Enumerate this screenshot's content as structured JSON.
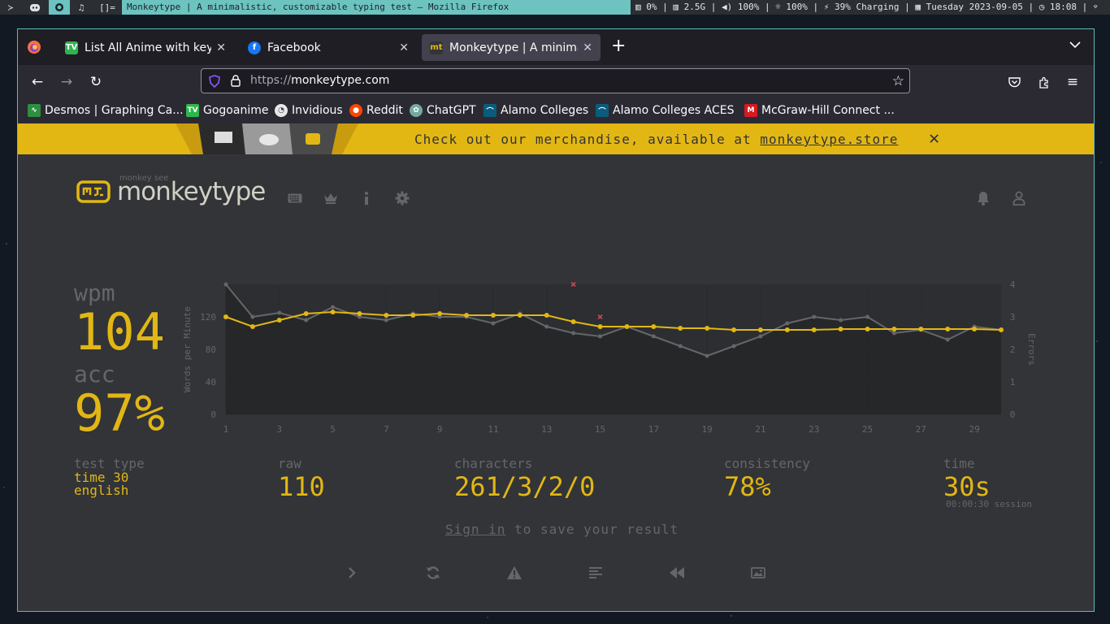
{
  "system_bar": {
    "window_title": "Monkeytype | A minimalistic, customizable typing test — Mozilla Firefox",
    "status_text": "▥ 0% | ▥ 2.5G | ◀) 100% | ☼ 100% | ⚡ 39% Charging | ▦ Tuesday 2023-09-05 | ◷ 18:08 | ⌔"
  },
  "browser": {
    "tabs": [
      {
        "label": "List All Anime with keyw",
        "active": false
      },
      {
        "label": "Facebook",
        "active": false
      },
      {
        "label": "Monkeytype | A minimal",
        "active": true
      }
    ],
    "url_protocol": "https://",
    "url_host": "monkeytype.com",
    "bookmarks": [
      "Desmos | Graphing Ca...",
      "Gogoanime",
      "Invidious",
      "Reddit",
      "ChatGPT",
      "Alamo Colleges",
      "Alamo Colleges ACES",
      "McGraw-Hill Connect ..."
    ]
  },
  "banner": {
    "text": "Check out our merchandise, available at ",
    "link": "monkeytype.store"
  },
  "header": {
    "tagline": "monkey see",
    "brand": "monkeytype"
  },
  "result": {
    "wpm_label": "wpm",
    "wpm": "104",
    "acc_label": "acc",
    "acc": "97%",
    "test_type_label": "test type",
    "test_type_1": "time 30",
    "test_type_2": "english",
    "raw_label": "raw",
    "raw": "110",
    "characters_label": "characters",
    "characters": "261/3/2/0",
    "consistency_label": "consistency",
    "consistency": "78%",
    "time_label": "time",
    "time": "30s",
    "session": "00:00:30 session",
    "signin_link": "Sign in",
    "signin_rest": " to save your result"
  },
  "chart_data": {
    "type": "line",
    "ylabel": "Words per Minute",
    "y2label": "Errors",
    "ylim": [
      0,
      160
    ],
    "y2lim": [
      0,
      4
    ],
    "yticks": [
      "0",
      "40",
      "80",
      "120"
    ],
    "y2ticks": [
      "0",
      "1",
      "2",
      "3",
      "4"
    ],
    "xticks": [
      "1",
      "3",
      "5",
      "7",
      "9",
      "11",
      "13",
      "15",
      "17",
      "19",
      "21",
      "23",
      "25",
      "27",
      "29"
    ],
    "x": [
      1,
      2,
      3,
      4,
      5,
      6,
      7,
      8,
      9,
      10,
      11,
      12,
      13,
      14,
      15,
      16,
      17,
      18,
      19,
      20,
      21,
      22,
      23,
      24,
      25,
      26,
      27,
      28,
      29,
      30
    ],
    "series": [
      {
        "name": "raw",
        "color": "#646669",
        "values": [
          160,
          120,
          125,
          116,
          132,
          120,
          116,
          124,
          120,
          120,
          112,
          124,
          108,
          100,
          96,
          108,
          96,
          84,
          72,
          84,
          96,
          112,
          120,
          116,
          120,
          100,
          104,
          92,
          108,
          104
        ]
      },
      {
        "name": "wpm",
        "color": "#e2b714",
        "values": [
          120,
          108,
          116,
          124,
          126,
          124,
          122,
          122,
          124,
          122,
          122,
          122,
          122,
          114,
          108,
          108,
          108,
          106,
          106,
          104,
          104,
          104,
          104,
          105,
          105,
          105,
          105,
          105,
          105,
          104
        ]
      }
    ],
    "errors": [
      {
        "x": 14,
        "y": 4
      },
      {
        "x": 15,
        "y": 3
      }
    ]
  }
}
